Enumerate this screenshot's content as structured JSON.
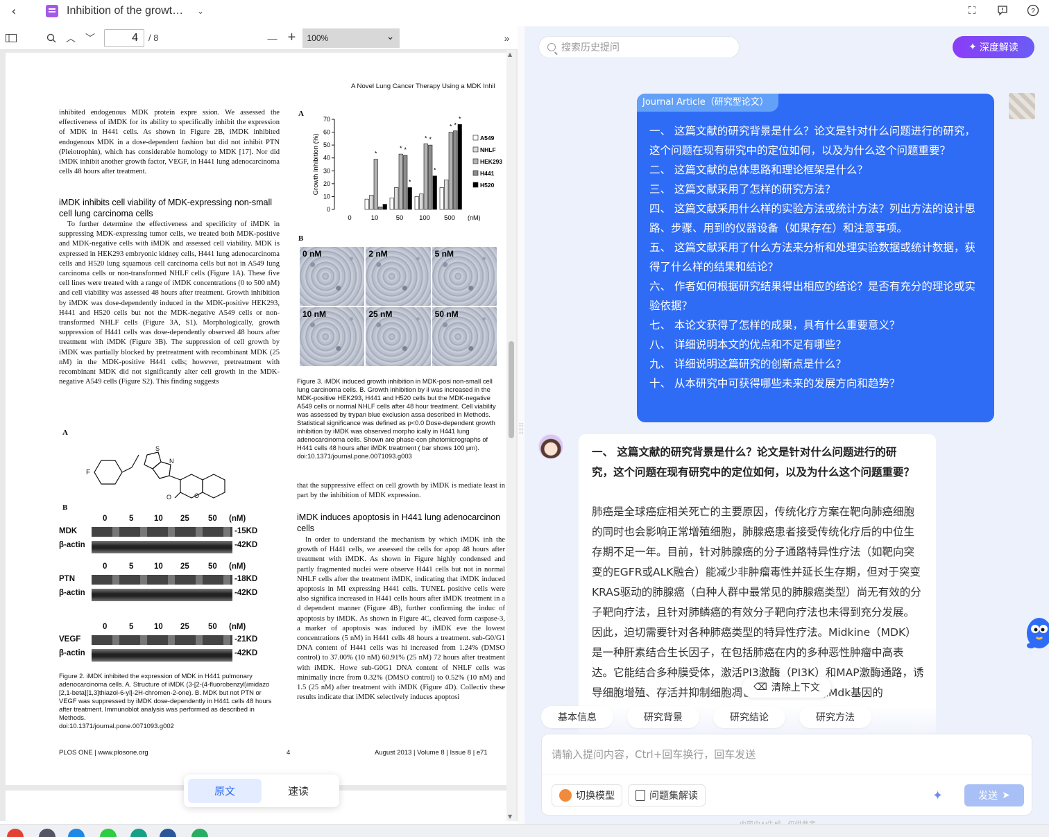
{
  "app": {
    "doc_title": "Inhibition of the growt…",
    "icons": [
      "back-icon",
      "document-icon",
      "chevron-down-icon",
      "fullscreen-icon",
      "feedback-icon",
      "help-icon"
    ]
  },
  "pdf_toolbar": {
    "page_current": "4",
    "page_total": "/ 8",
    "zoom": "100%"
  },
  "page": {
    "running_head": "A Novel Lung Cancer Therapy Using a MDK Inhil",
    "left_para1": "inhibited endogenous MDK protein expre ssion. We assessed the effectiveness of iMDK for its ability to specifically inhibit the expression of MDK in H441 cells. As shown in Figure 2B, iMDK inhibited endogenous MDK in a dose-dependent fashion but did not inhibit PTN (Pleiotrophin), which has considerable homology to MDK [17]. Nor did iMDK inhibit another growth factor, VEGF, in H441 lung adenocarcinoma cells 48 hours after treatment.",
    "left_heading": "iMDK inhibits cell viability of MDK-expressing non-small cell lung carcinoma cells",
    "left_para2": "To further determine the effectiveness and specificity of iMDK in suppressing MDK-expressing tumor cells, we treated both MDK-positive and MDK-negative cells with iMDK and assessed cell viability. MDK is expressed in HEK293 embryonic kidney cells, H441 lung adenocarcinoma cells and H520 lung squamous cell carcinoma cells but not in A549 lung carcinoma cells or non-transformed NHLF cells (Figure 1A). These five cell lines were treated with a range of iMDK concentrations (0 to 500 nM) and cell viability was assessed 48 hours after treatment. Growth inhibition by iMDK was dose-dependently induced in the MDK-positive HEK293, H441 and H520 cells but not the MDK-negative A549 cells or non-transformed NHLF cells (Figure 3A, S1). Morphologically, growth suppression of H441 cells was dose-dependently observed 48 hours after treatment with iMDK (Figure 3B). The suppression of cell growth by iMDK was partially blocked by pretreatment with recombinant MDK (25 nM) in the MDK-positive H441 cells; however, pretreatment with recombinant MDK did not significantly alter cell growth in the MDK-negative A549 cells (Figure S2). This finding suggests",
    "fig2_A": "A",
    "fig2_B": "B",
    "blot_doses": [
      "0",
      "5",
      "10",
      "25",
      "50",
      "(nM)"
    ],
    "blot_labels": {
      "mdk": "MDK",
      "mdk_kd": "-15KD",
      "actin": "β-actin",
      "actin_kd": "-42KD",
      "ptn": "PTN",
      "ptn_kd": "-18KD",
      "vegf": "VEGF",
      "vegf_kd": "-21KD"
    },
    "fig2_caption": "Figure 2. iMDK inhibited the expression of MDK in H441 pulmonary adenocarcinoma cells. A. Structure of iMDK (3-[2-(4-fluorobenzyl)imidazo [2,1-beta][1,3]thiazol-6-yl]-2H-chromen-2-one). B. MDK but not PTN or VEGF was suppressed by iMDK dose-dependently in H441 cells 48 hours after treatment. Immunoblot analysis was performed as described in Methods.",
    "fig2_doi": "doi:10.1371/journal.pone.0071093.g002",
    "fig3_A": "A",
    "fig3_B": "B",
    "micro_labels": [
      "0 nM",
      "2 nM",
      "5 nM",
      "10 nM",
      "25 nM",
      "50 nM"
    ],
    "fig3_caption": "Figure 3. iMDK induced growth inhibition in MDK-posi non-small cell lung carcinoma cells. B. Growth inhibition by il was increased in the MDK-positive HEK293, H441 and H520 cells but the MDK-negative A549 cells or normal NHLF cells after 48 hour treatment. Cell viability was assessed by trypan blue exclusion assa described in Methods. Statistical significance was defined as p<0.0 Dose-dependent growth inhibition by iMDK was observed morpho ically in H441 lung adenocarcinoma cells. Shown are phase-con photomicrographs of H441 cells 48 hours after iMDK treatment ( bar shows 100 μm).",
    "fig3_doi": "doi:10.1371/journal.pone.0071093.g003",
    "right_para1": "that the suppressive effect on cell growth by iMDK is mediate least in part by the inhibition of MDK expression.",
    "right_heading": "iMDK induces apoptosis in H441 lung adenocarcinon cells",
    "right_para2": "In order to understand the mechanism by which iMDK inh the growth of H441 cells, we assessed the cells for apop 48 hours after treatment with iMDK. As shown in Figure highly condensed and partly fragmented nuclei were observe H441 cells but not in normal NHLF cells after the treatment iMDK, indicating that iMDK induced apoptosis in MI expressing H441 cells. TUNEL positive cells were also significa increased in H441 cells hours after iMDK treatment in a d dependent manner (Figure 4B), further confirming the induc of apoptosis by iMDK. As shown in Figure 4C, cleaved form caspase-3, a marker of apoptosis was induced by iMDK eve the lowest concentrations (5 nM) in H441 cells 48 hours a treatment. sub-G0/G1 DNA content of H441 cells was hi increased from 1.24% (DMSO control) to 37.00% (10 nM) 60.91% (25 nM) 72 hours after treatment with iMDK. Howe sub-G0G1 DNA content of NHLF cells was minimally incre from 0.32% (DMSO control) to 0.52% (10 nM) and 1.5 (25 nM) after treatment with iMDK (Figure 4D). Collectiv these results indicate that iMDK selectively induces apoptosi",
    "footer_left": "PLOS ONE | www.plosone.org",
    "footer_mid": "4",
    "footer_right": "August 2013 | Volume 8 | Issue 8 | e71"
  },
  "chart_data": {
    "type": "bar",
    "title": "",
    "xlabel": "(nM)",
    "ylabel": "Growth Inhibition (%)",
    "ylim": [
      0,
      70
    ],
    "yticks": [
      0,
      10,
      20,
      30,
      40,
      50,
      60,
      70
    ],
    "categories": [
      "0",
      "10",
      "50",
      "100",
      "500"
    ],
    "series": [
      {
        "name": "A549",
        "color": "#ffffff",
        "values": [
          0,
          8,
          9,
          10,
          17
        ]
      },
      {
        "name": "NHLF",
        "color": "#dcdcdc",
        "values": [
          0,
          11,
          17,
          12,
          23
        ]
      },
      {
        "name": "HEK293",
        "color": "#b4b4b4",
        "values": [
          0,
          39,
          43,
          51,
          60
        ]
      },
      {
        "name": "H441",
        "color": "#8c8c8c",
        "values": [
          0,
          2,
          42,
          50,
          61
        ]
      },
      {
        "name": "H520",
        "color": "#000000",
        "values": [
          0,
          4,
          17,
          26,
          66
        ]
      }
    ],
    "legend": "right"
  },
  "mode_toggle": {
    "original": "原文",
    "speed": "速读"
  },
  "chat": {
    "search_placeholder": "搜索历史提问",
    "deep_button": "深度解读",
    "article_tag": "Journal Article（研究型论文）",
    "questions": [
      "一、 这篇文献的研究背景是什么？论文是针对什么问题进行的研究，这个问题在现有研究中的定位如何，以及为什么这个问题重要？",
      "二、 这篇文献的总体思路和理论框架是什么？",
      "三、 这篇文献采用了怎样的研究方法？",
      "四、 这篇文献采用什么样的实验方法或统计方法？列出方法的设计思路、步骤、用到的仪器设备（如果存在）和注意事项。",
      "五、 这篇文献采用了什么方法来分析和处理实验数据或统计数据，获得了什么样的结果和结论？",
      "六、 作者如何根据研究结果得出相应的结论？是否有充分的理论或实验依据？",
      "七、 本论文获得了怎样的成果，具有什么重要意义？",
      "八、 详细说明本文的优点和不足有哪些？",
      "九、 详细说明这篇研究的创新点是什么？",
      "十、 从本研究中可获得哪些未来的发展方向和趋势？"
    ],
    "answer_question": "一、 这篇文献的研究背景是什么？论文是针对什么问题进行的研究，这个问题在现有研究中的定位如何，以及为什么这个问题重要？",
    "answer_text": "肺癌是全球癌症相关死亡的主要原因，传统化疗方案在靶向肺癌细胞的同时也会影响正常增殖细胞，肺腺癌患者接受传统化疗后的中位生存期不足一年。目前，针对肺腺癌的分子通路特异性疗法（如靶向突变的EGFR或ALK融合）能减少非肿瘤毒性并延长生存期，但对于突变KRAS驱动的肺腺癌（白种人群中最常见的肺腺癌类型）尚无有效的分子靶向疗法，且针对肺鳞癌的有效分子靶向疗法也未得到充分发展。因此，迫切需要针对各种肺癌类型的特异性疗法。Midkine（MDK）是一种肝素结合生长因子，在包括肺癌在内的多种恶性肿瘤中高表达。它能结合多种膜受体，激活PI3激酶（PI3K）和MAP激酶通路，诱导细胞增殖、存活并抑制细胞凋亡活性。通过敲除Mdk基因的",
    "clear_context": "清除上下文",
    "quick_tags": [
      "基本信息",
      "研究背景",
      "研究结论",
      "研究方法"
    ],
    "input_placeholder": "请输入提问内容，Ctrl+回车换行，回车发送",
    "switch_model": "切换模型",
    "question_set": "问题集解读",
    "send": "发送",
    "footnote": "内容由AI生成，仅供参考"
  }
}
